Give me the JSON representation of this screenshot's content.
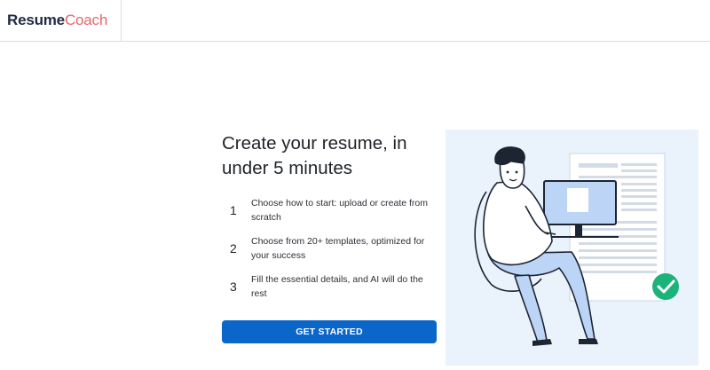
{
  "brand": {
    "part1": "Resume",
    "part2": "Coach"
  },
  "hero": {
    "headline": "Create your resume, in under 5 minutes"
  },
  "steps": [
    {
      "number": "1",
      "text": "Choose how to start: upload or create from scratch"
    },
    {
      "number": "2",
      "text": "Choose from 20+ templates, optimized for your success"
    },
    {
      "number": "3",
      "text": "Fill the essential details, and AI will do the rest"
    }
  ],
  "cta": {
    "label": "GET STARTED"
  },
  "colors": {
    "accent": "#0a66c8",
    "brand_dark": "#1f2a44",
    "brand_coral": "#e2686c",
    "success": "#1bb37a",
    "illustration_bg": "#eaf2fc"
  }
}
